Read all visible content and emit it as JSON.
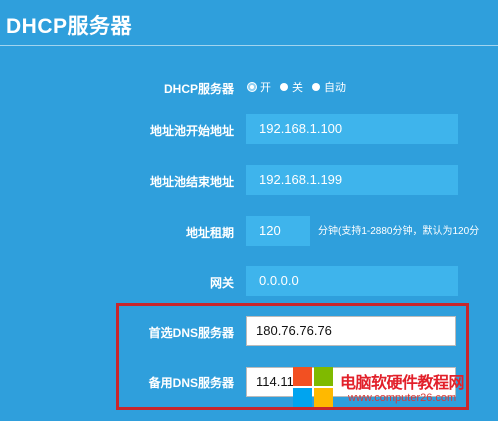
{
  "page_title": "DHCP服务器",
  "dhcp": {
    "label": "DHCP服务器",
    "options": [
      {
        "label": "开",
        "selected": true
      },
      {
        "label": "关",
        "selected": false
      },
      {
        "label": "自动",
        "selected": false
      }
    ]
  },
  "pool_start": {
    "label": "地址池开始地址",
    "value": "192.168.1.100"
  },
  "pool_end": {
    "label": "地址池结束地址",
    "value": "192.168.1.199"
  },
  "lease": {
    "label": "地址租期",
    "value": "120",
    "hint": "分钟(支持1-2880分钟，默认为120分"
  },
  "gateway": {
    "label": "网关",
    "value": "0.0.0.0"
  },
  "primary_dns": {
    "label": "首选DNS服务器",
    "value": "180.76.76.76"
  },
  "secondary_dns": {
    "label": "备用DNS服务器",
    "value": "114.11"
  },
  "watermark": {
    "title": "电脑软硬件教程网",
    "url": "www.computer26.com"
  },
  "colors": {
    "background": "#2f9fdc",
    "field": "#3eb4ec",
    "highlight_box": "#c8262b"
  }
}
